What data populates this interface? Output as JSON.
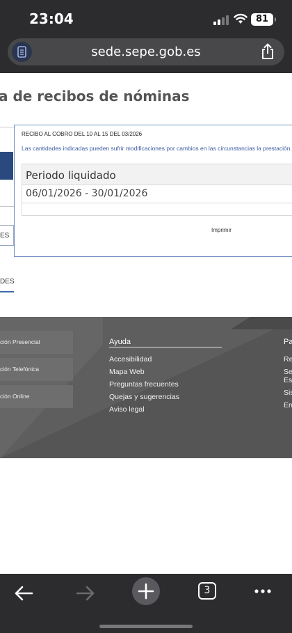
{
  "status_bar": {
    "time": "23:04",
    "battery": "81",
    "icons": [
      "signal-icon",
      "wifi-icon",
      "battery-icon"
    ]
  },
  "browser": {
    "url": "sede.sepe.gob.es",
    "open_tabs": "3",
    "icons": [
      "reader-icon",
      "share-icon",
      "back-arrow-icon",
      "forward-arrow-icon",
      "plus-icon",
      "tabs-icon",
      "more-icon"
    ]
  },
  "page": {
    "title": "a de recibos de nóminas"
  },
  "sidebar": {
    "label_1": "ES",
    "label_2": "DES"
  },
  "receipt": {
    "heading": "RECIBO AL COBRO DEL 10 AL 15 DEL 03/2026",
    "note": "Las cantidades indicadas pueden sufrir modificaciones por cambios en las circunstancias la prestación.",
    "period_label": "Periodo liquidado",
    "period_start": "06/01/2026",
    "period_separator": "-",
    "period_end": "30/01/2026",
    "print_label": "Imprimir"
  },
  "footer": {
    "services": [
      "ción Presencial",
      "ción Telefónica",
      "ción Online"
    ],
    "help_title": "Ayuda",
    "help_items": [
      "Accesibilidad",
      "Mapa Web",
      "Preguntas frecuentes",
      "Quejas y sugerencias",
      "Aviso legal"
    ],
    "right_title": "Pa",
    "right_items": [
      "Re",
      "Se",
      "Es",
      "Sis",
      "En"
    ]
  },
  "colors": {
    "chrome": "#2c2c2e",
    "url_bar": "#48484a",
    "brand_blue": "#2a4a7f",
    "link_blue": "#3a5aa0",
    "footer_bg": "#555555"
  }
}
